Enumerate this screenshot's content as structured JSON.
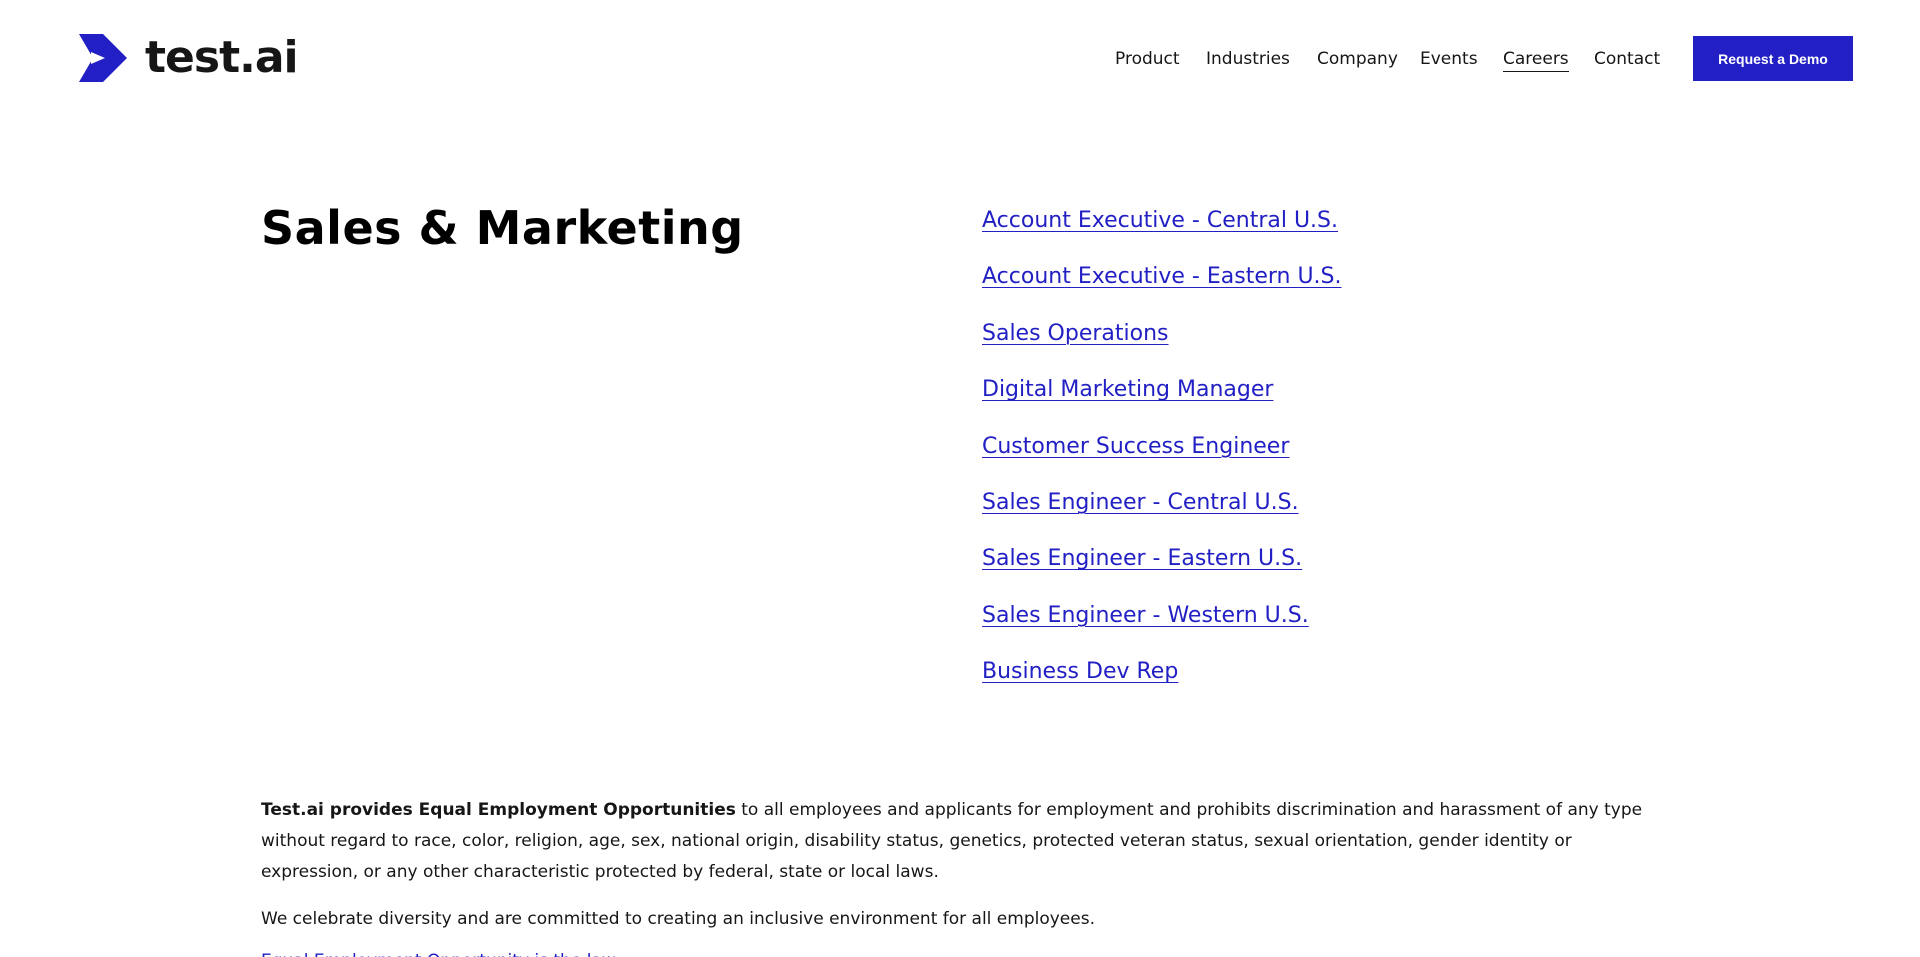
{
  "header": {
    "logo_text": "test.ai",
    "nav": [
      {
        "label": "Product"
      },
      {
        "label": "Industries"
      },
      {
        "label": "Company"
      },
      {
        "label": "Events"
      },
      {
        "label": "Careers",
        "active": true
      },
      {
        "label": "Contact"
      }
    ],
    "demo_button": "Request a Demo"
  },
  "section": {
    "title": "Sales & Marketing",
    "jobs": [
      "Account Executive - Central U.S.",
      "Account Executive - Eastern U.S.",
      "Sales Operations",
      "Digital Marketing Manager",
      "Customer Success Engineer",
      "Sales Engineer - Central U.S.",
      "Sales Engineer - Eastern U.S.",
      "Sales Engineer - Western U.S.",
      "Business Dev Rep"
    ]
  },
  "eeo": {
    "bold_lead": "Test.ai provides Equal Employment Opportunities",
    "body": " to all employees and applicants for employment and prohibits discrimination and harassment of any type without regard to race, color, religion, age, sex, national origin, disability status, genetics, protected veteran status, sexual orientation, gender identity or expression, or any other characteristic protected by federal, state or local laws.",
    "diversity": "We celebrate diversity and are committed to creating an inclusive environment for all employees.",
    "link_text": "Equal Employment Opportunity is the law"
  },
  "colors": {
    "brand": "#2220c4",
    "text": "#161616"
  }
}
